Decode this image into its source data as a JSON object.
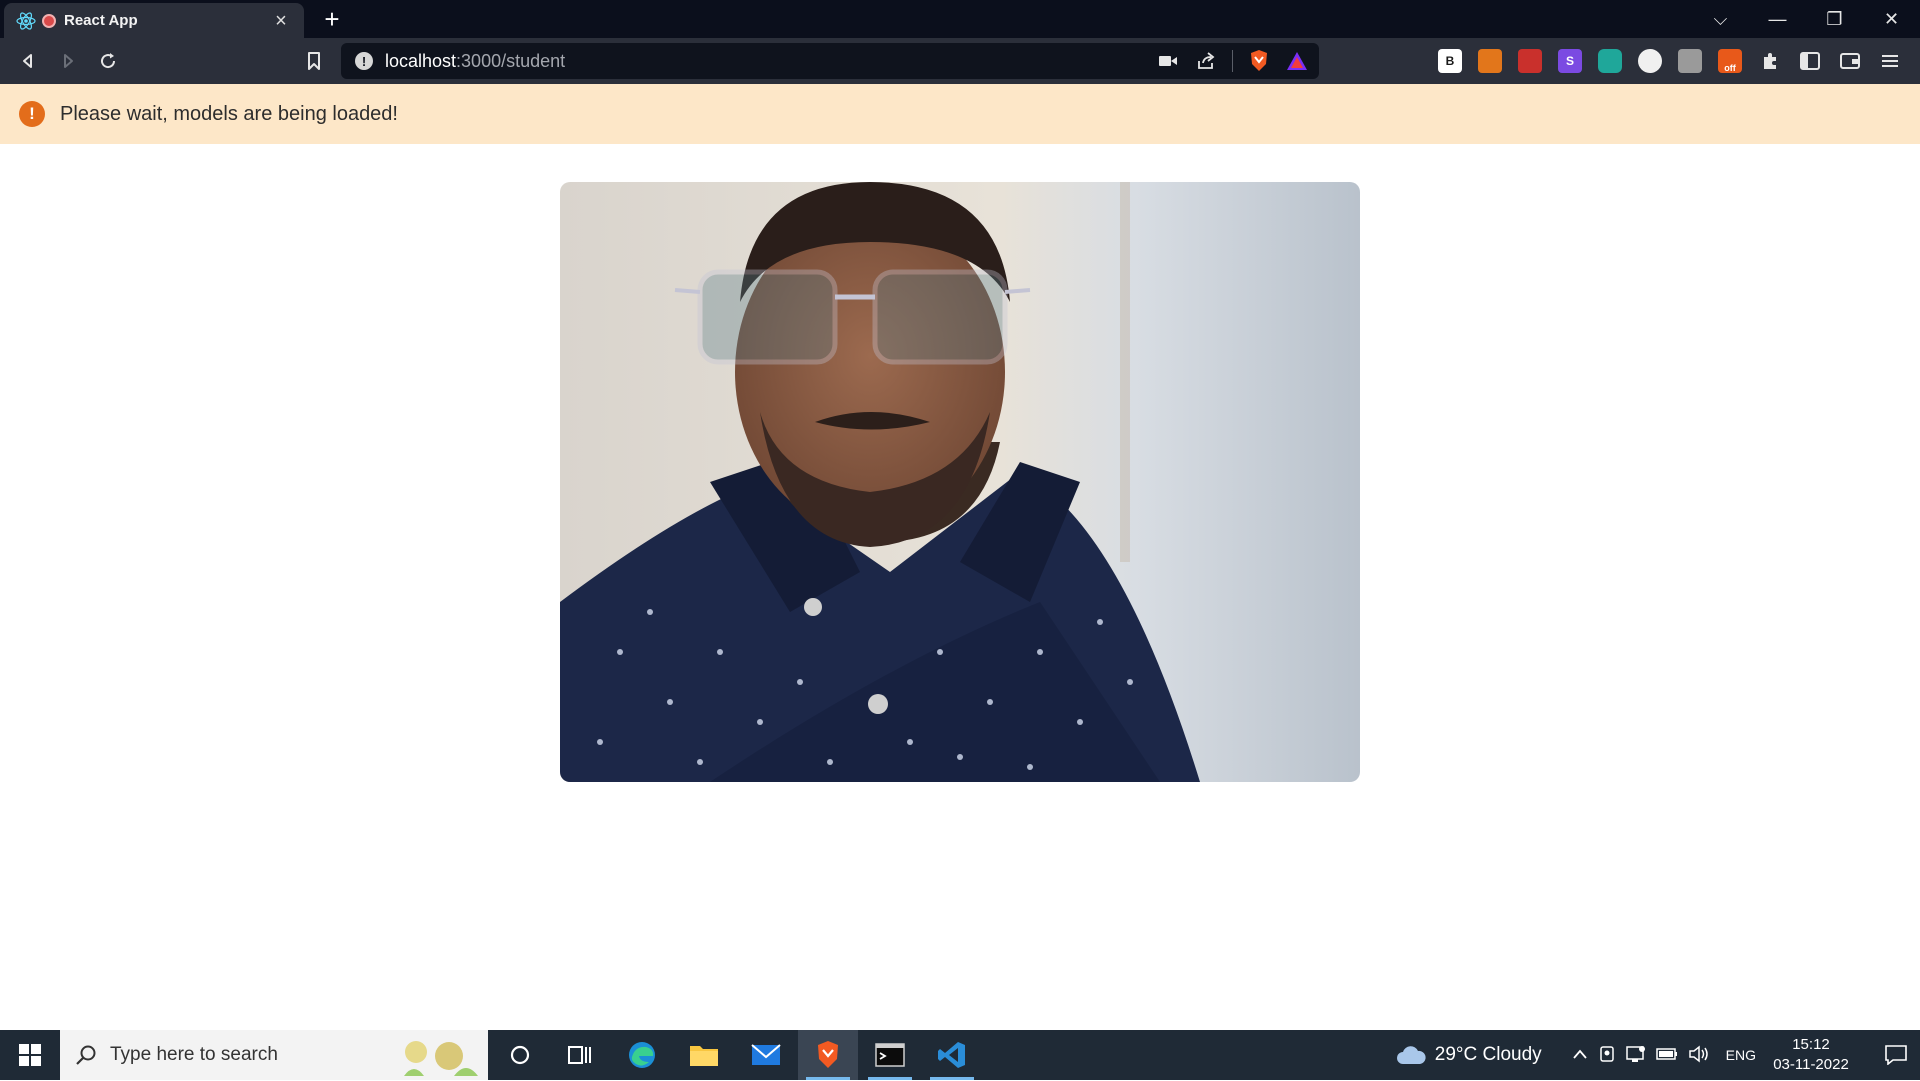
{
  "browser": {
    "tab_title": "React App",
    "tab_close": "×",
    "new_tab": "+",
    "url_host": "localhost",
    "url_path": ":3000/student",
    "window_controls": {
      "dropdown": "⌵",
      "minimize": "—",
      "restore": "❐",
      "close": "✕"
    },
    "extensions": [
      {
        "name": "b-extension-icon",
        "label": "B",
        "color": "#ffffff",
        "text_color": "#1a1a1a"
      },
      {
        "name": "metamask-icon",
        "label": "",
        "color": "#e2761b",
        "text_color": "#ffffff"
      },
      {
        "name": "red-extension-icon",
        "label": "",
        "color": "#c9302c",
        "text_color": "#ffffff"
      },
      {
        "name": "s-extension-icon",
        "label": "S",
        "color": "#7b4ae2",
        "text_color": "#ffffff"
      },
      {
        "name": "teal-extension-icon",
        "label": "",
        "color": "#1fa79a",
        "text_color": "#ffffff"
      },
      {
        "name": "circle-extension-icon",
        "label": "",
        "color": "#f0f0f0",
        "text_color": "#111111"
      },
      {
        "name": "grey-extension-icon",
        "label": "",
        "color": "#9a9a9a",
        "text_color": "#ffffff"
      },
      {
        "name": "off-extension-icon",
        "label": "off",
        "color": "#e8591a",
        "text_color": "#ffffff"
      }
    ]
  },
  "alert": {
    "icon": "!",
    "message": "Please wait, models are being loaded!"
  },
  "taskbar": {
    "search_placeholder": "Type here to search",
    "weather": "29°C  Cloudy",
    "language": "ENG",
    "time": "15:12",
    "date": "03-11-2022"
  },
  "colors": {
    "alert_bg": "#fde7c8",
    "alert_icon": "#e36d1b",
    "chrome_dark": "#0b0f1c",
    "toolbar": "#2b2f3a",
    "taskbar": "#1f2a36"
  }
}
